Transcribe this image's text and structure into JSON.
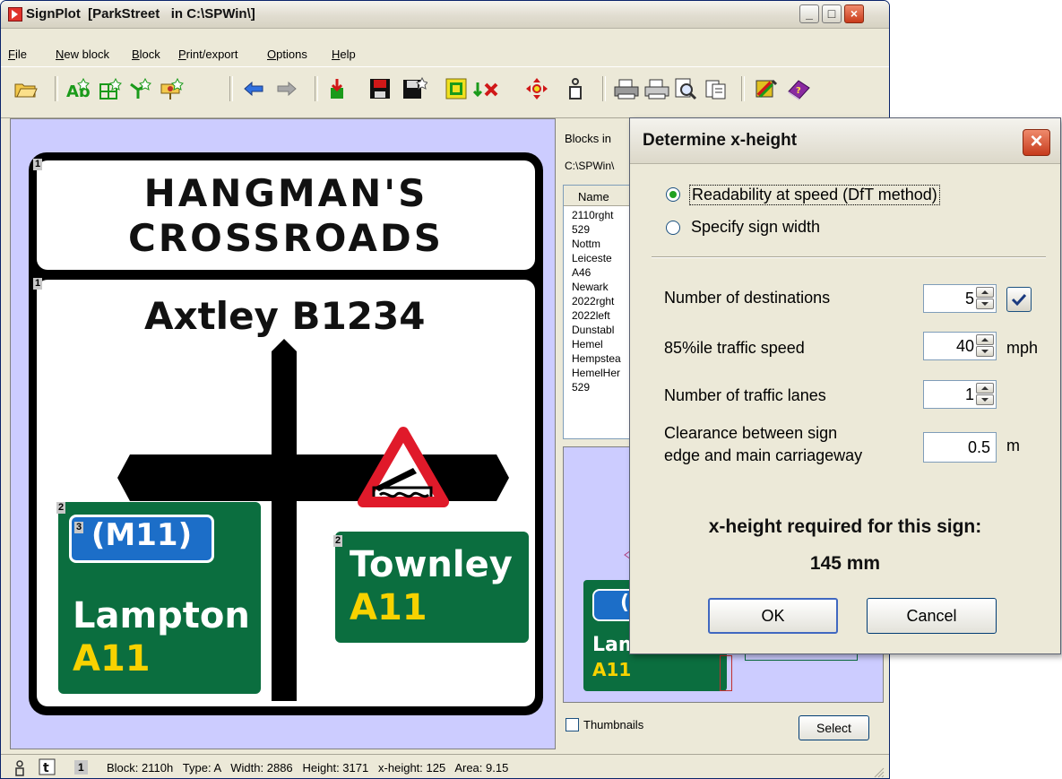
{
  "window": {
    "title": "SignPlot  [ParkStreet   in C:\\SPWin\\]",
    "controls": {
      "minimize": "_",
      "maximize": "□",
      "close": "×"
    }
  },
  "menu": [
    "File",
    "New block",
    "Block",
    "Print/export",
    "Options",
    "Help"
  ],
  "toolbar": {
    "icons": [
      "open-folder-icon",
      "new-text-block-icon",
      "new-panel-block-icon",
      "new-arrow-block-icon",
      "new-symbol-block-icon",
      "arrow-left-icon",
      "arrow-right-icon",
      "import-block-icon",
      "save-icon",
      "save-as-icon",
      "copy-block-icon",
      "delete-block-icon",
      "move-block-icon",
      "person-block-icon",
      "print-icon",
      "print-setup-icon",
      "print-preview-icon",
      "clipboard-copy-icon",
      "palette-icon",
      "help-book-icon"
    ]
  },
  "sign": {
    "top_line1": "HANGMAN'S",
    "top_line2": "CROSSROADS",
    "main_dest": "Axtley B1234",
    "tag_top": "1",
    "tag_main": "1",
    "tag_left_panel": "2",
    "tag_m11": "3",
    "tag_right_panel": "2",
    "m11": "(M11)",
    "left_dest": "Lampton",
    "left_route": "A11",
    "right_dest": "Townley",
    "right_route": "A11",
    "colors": {
      "green": "#0b6e3f",
      "blue": "#1c6ec8",
      "yellow": "#f8d200",
      "red": "#e01a2a"
    }
  },
  "blocks_panel": {
    "label1": "Blocks in",
    "label2": "C:\\SPWin\\",
    "list_header": "Name",
    "items": [
      "2110rght",
      "529",
      "Nottm",
      "Leiceste",
      "A46",
      "Newark",
      "2022rght",
      "2022left",
      "Dunstabl",
      "Hemel",
      "Hempstea",
      "HemelHer",
      "529"
    ],
    "thumb_m": "(M",
    "thumb_dest": "Lam",
    "thumb_route": "A11",
    "thumbnails_label": "Thumbnails",
    "select_label": "Select"
  },
  "statusbar": {
    "tag": "1",
    "text": "Block: 2110h   Type: A   Width: 2886   Height: 3171   x-height: 125   Area: 9.15"
  },
  "dialog": {
    "title": "Determine x-height",
    "option1": "Readability at speed (DfT method)",
    "option2": "Specify sign width",
    "selected_option": "Readability at speed (DfT method)",
    "rows": {
      "destinations_label": "Number of destinations",
      "destinations_value": "5",
      "destinations_checked": true,
      "speed_label": "85%ile traffic speed",
      "speed_value": "40",
      "speed_unit": "mph",
      "lanes_label": "Number of traffic lanes",
      "lanes_value": "1",
      "clearance_label1": "Clearance between sign",
      "clearance_label2": "edge and main carriageway",
      "clearance_value": "0.5",
      "clearance_unit": "m"
    },
    "result_label": "x-height required for this sign:",
    "result_value": "145 mm",
    "ok_label": "OK",
    "cancel_label": "Cancel"
  }
}
